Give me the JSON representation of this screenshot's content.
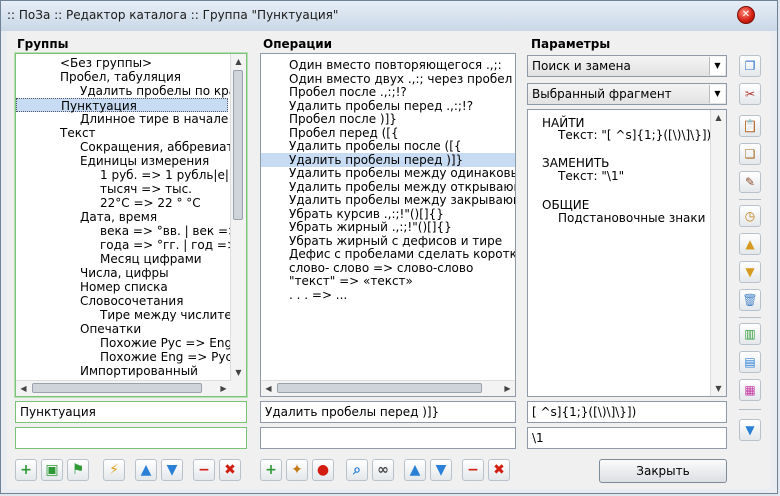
{
  "window": {
    "title": ":: ПоЗа :: Редактор каталога :: Группа \"Пунктуация\""
  },
  "groups": {
    "header": "Группы",
    "items": [
      {
        "label": "<Без группы>",
        "indent": 1
      },
      {
        "label": "Пробел, табуляция",
        "indent": 1
      },
      {
        "label": "Удалить пробелы по краям",
        "indent": 2
      },
      {
        "label": "Пунктуация",
        "indent": 1,
        "selected": true
      },
      {
        "label": "Длинное тире в начале и",
        "indent": 2
      },
      {
        "label": "Текст",
        "indent": 1
      },
      {
        "label": "Сокращения, аббревиатуры",
        "indent": 2
      },
      {
        "label": "Единицы измерения",
        "indent": 2
      },
      {
        "label": "1 руб. => 1 рубль|е|",
        "indent": 3
      },
      {
        "label": "тысяч => тыс.",
        "indent": 3
      },
      {
        "label": "22°C => 22 ° °C",
        "indent": 3
      },
      {
        "label": "Дата, время",
        "indent": 2
      },
      {
        "label": "века => °вв. | век =>",
        "indent": 3
      },
      {
        "label": "года => °гг. | год =>",
        "indent": 3
      },
      {
        "label": "Месяц цифрами",
        "indent": 3
      },
      {
        "label": "Числа, цифры",
        "indent": 2
      },
      {
        "label": "Номер списка",
        "indent": 2
      },
      {
        "label": "Словосочетания",
        "indent": 2
      },
      {
        "label": "Тире между числитель",
        "indent": 3
      },
      {
        "label": "Опечатки",
        "indent": 2
      },
      {
        "label": "Похожие Рус => Eng",
        "indent": 3
      },
      {
        "label": "Похожие Eng => Рус",
        "indent": 3
      },
      {
        "label": "Импортированный",
        "indent": 2
      }
    ],
    "name_value": "Пунктуация",
    "extra_value": ""
  },
  "operations": {
    "header": "Операции",
    "items": [
      "Один вместо повторяющегося .,;:",
      "Один вместо двух .,:; через пробел",
      "Пробел после .,:;!?",
      "Удалить пробелы перед .,:;!?",
      "Пробел после )]}",
      "Пробел перед ([{",
      "Удалить пробелы после ([{",
      "Удалить пробелы перед )]}",
      "Удалить пробелы между одинаковыми",
      "Удалить пробелы между открывающим",
      "Удалить пробелы между закрывающим",
      "Убрать курсив .,:;!\"()[]{}",
      "Убрать жирный .,:;!\"()[]{}",
      "Убрать жирный с дефисов и тире",
      "Дефис с пробелами сделать коротким",
      "слово- слово => слово-слово",
      "\"текст\" => «текст»",
      ". . . => ..."
    ],
    "selected_index": 7,
    "name_value": "Удалить пробелы перед )]}",
    "extra_value": ""
  },
  "params": {
    "header": "Параметры",
    "mode_combo": "Поиск и замена",
    "scope_combo": "Выбранный фрагмент",
    "find_heading": "НАЙТИ",
    "find_text": "Текст: \"[ ^s]{1;}([\\)\\]\\}])\"",
    "replace_heading": "ЗАМЕНИТЬ",
    "replace_text": "Текст: \"\\1\"",
    "general_heading": "ОБЩИЕ",
    "general_text": "Подстановочные знаки",
    "find_value": "[ ^s]{1;}([\\)\\]\\}])",
    "replace_value": "\\1"
  },
  "buttons": {
    "close_label": "Закрыть",
    "window_close_glyph": "✕"
  },
  "icons": {
    "add": "+",
    "folder": "▣",
    "flag": "⚑",
    "flash": "⚡",
    "up": "▲",
    "down": "▼",
    "minus": "−",
    "delete": "✖",
    "wand": "✦",
    "record": "●",
    "search": "⌕",
    "binoculars": "∞",
    "copy": "❐",
    "cut": "✂",
    "clipboard": "📋",
    "paste": "❏",
    "eraser": "✎",
    "clock": "◷",
    "like": "▲",
    "dislike": "▼",
    "trash": "🗑",
    "panel1": "▥",
    "panel2": "▤",
    "panel3": "▦",
    "down_arrow": "▼",
    "scroll_up": "▲",
    "scroll_down": "▼",
    "scroll_left": "◀",
    "scroll_right": "▶"
  },
  "colors": {
    "green_accent": "#7bc278",
    "selection": "#c7dcf2",
    "red": "#d21d10",
    "blue": "#2a7fd6"
  }
}
